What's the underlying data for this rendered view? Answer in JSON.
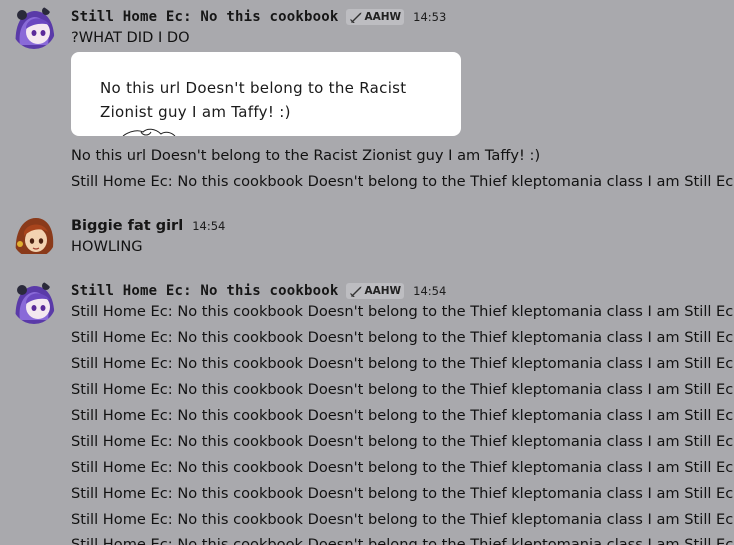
{
  "messages": [
    {
      "username": "Still Home Ec: No this cookbook",
      "tag": "AAHW",
      "time": "14:53",
      "lines": [
        "?WHAT DID I DO"
      ],
      "embed_text": "No this url Doesn't belong to the Racist Zionist guy I am Taffy! :)",
      "after_lines": [
        "No this url Doesn't belong to the Racist Zionist guy I am Taffy! :)",
        "Still Home Ec: No this cookbook Doesn't belong to the Thief kleptomania class I am Still Ec! :)"
      ]
    },
    {
      "username": "Biggie fat girl",
      "time": "14:54",
      "lines": [
        "HOWLING"
      ]
    },
    {
      "username": "Still Home Ec: No this cookbook",
      "tag": "AAHW",
      "time": "14:54",
      "lines": [
        "Still Home Ec: No this cookbook Doesn't belong to the Thief kleptomania class I am Still Ec! :)",
        "Still Home Ec: No this cookbook Doesn't belong to the Thief kleptomania class I am Still Ec! :)",
        "Still Home Ec: No this cookbook Doesn't belong to the Thief kleptomania class I am Still Ec! :)",
        "Still Home Ec: No this cookbook Doesn't belong to the Thief kleptomania class I am Still Ec! :)",
        "Still Home Ec: No this cookbook Doesn't belong to the Thief kleptomania class I am Still Ec! :)",
        "Still Home Ec: No this cookbook Doesn't belong to the Thief kleptomania class I am Still Ec! :)",
        "Still Home Ec: No this cookbook Doesn't belong to the Thief kleptomania class I am Still Ec! :)",
        "Still Home Ec: No this cookbook Doesn't belong to the Thief kleptomania class I am Still Ec! :)",
        "Still Home Ec: No this cookbook Doesn't belong to the Thief kleptomania class I am Still Ec! :)",
        "Still Home Ec: No this cookbook Doesn't belong to the Thief kleptomania class I am Still Ec! :)"
      ]
    }
  ],
  "icons": {
    "avatar_1": "purple-hair-girl-avatar",
    "avatar_2": "brown-hair-girl-avatar",
    "tag_icon": "sword-icon"
  },
  "colors": {
    "background": "#a9a9ad",
    "embed_background": "#ffffff"
  }
}
